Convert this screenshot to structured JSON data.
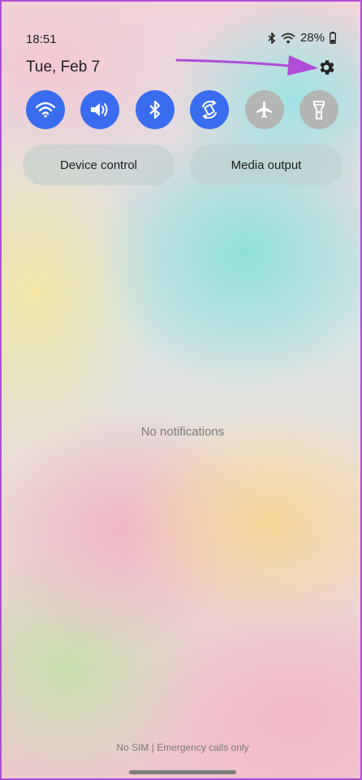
{
  "status_bar": {
    "time": "18:51",
    "battery": "28%",
    "icons": [
      "bluetooth-icon",
      "wifi-icon",
      "battery-icon"
    ]
  },
  "header": {
    "date": "Tue, Feb 7",
    "settings_icon": "gear-icon"
  },
  "quick_tiles": [
    {
      "icon": "wifi-icon",
      "state": "on"
    },
    {
      "icon": "sound-icon",
      "state": "on"
    },
    {
      "icon": "bluetooth-icon",
      "state": "on"
    },
    {
      "icon": "auto-rotate-icon",
      "state": "on"
    },
    {
      "icon": "airplane-icon",
      "state": "off"
    },
    {
      "icon": "flashlight-icon",
      "state": "off"
    }
  ],
  "buttons": {
    "device_control": "Device control",
    "media_output": "Media output"
  },
  "notifications": {
    "empty_text": "No notifications"
  },
  "footer": {
    "carrier_text": "No SIM | Emergency calls only"
  },
  "colors": {
    "tile_on": "#3a6cf0",
    "tile_off": "#b3b6b4",
    "annotation_arrow": "#b04dd6"
  }
}
